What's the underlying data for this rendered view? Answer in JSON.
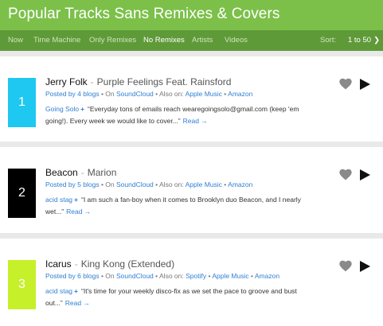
{
  "header": {
    "title": "Popular Tracks Sans Remixes & Covers"
  },
  "nav": {
    "items": [
      {
        "label": "Now"
      },
      {
        "label": "Time Machine"
      },
      {
        "label": "Only Remixes"
      },
      {
        "label": "No Remixes",
        "active": true
      },
      {
        "label": "Artists"
      },
      {
        "label": "Videos"
      }
    ],
    "sort_label": "Sort:",
    "sort_value": "1 to 50",
    "sort_chevron": "❯"
  },
  "colors": {
    "header_bg": "#7cc04a",
    "nav_bg": "#5f9a39",
    "link": "#2f7fd3",
    "rank_1": "#1ec8f0",
    "rank_2": "#000000",
    "rank_3": "#c6f02a"
  },
  "icons": {
    "heart": "heart-icon",
    "play": "play-icon"
  },
  "tracks": [
    {
      "rank": "1",
      "artist": "Jerry Folk",
      "separator": "-",
      "song": "Purple Feelings Feat. Rainsford",
      "posted_by": "Posted by 4 blogs",
      "bullet1": " • ",
      "on_label": "On ",
      "source": "SoundCloud",
      "bullet2": " • ",
      "also_on": "Also on: ",
      "links": [
        "Apple Music",
        "Amazon"
      ],
      "link_sep": " • ",
      "blog": "Going Solo",
      "plus": "+",
      "excerpt": "“Everyday tons of emails reach wearegoingsolo@gmail.com (keep 'em going!). Every week we would like to cover...”",
      "read_more": "Read →"
    },
    {
      "rank": "2",
      "artist": "Beacon",
      "separator": "-",
      "song": "Marion",
      "posted_by": "Posted by 5 blogs",
      "bullet1": " • ",
      "on_label": "On ",
      "source": "SoundCloud",
      "bullet2": " • ",
      "also_on": "Also on: ",
      "links": [
        "Apple Music",
        "Amazon"
      ],
      "link_sep": " • ",
      "blog": "acid stag",
      "plus": "+",
      "excerpt": "“I am such a fan-boy when it comes to Brooklyn duo Beacon, and I nearly wet...”",
      "read_more": "Read →"
    },
    {
      "rank": "3",
      "artist": "Icarus",
      "separator": "-",
      "song": "King Kong (Extended)",
      "posted_by": "Posted by 6 blogs",
      "bullet1": " • ",
      "on_label": "On ",
      "source": "SoundCloud",
      "bullet2": " • ",
      "also_on": "Also on: ",
      "links": [
        "Spotify",
        "Apple Music",
        "Amazon"
      ],
      "link_sep": " • ",
      "blog": "acid stag",
      "plus": "+",
      "excerpt": "“It's time for your weekly disco-fix as we set the pace to groove and bust out...”",
      "read_more": "Read →"
    }
  ]
}
